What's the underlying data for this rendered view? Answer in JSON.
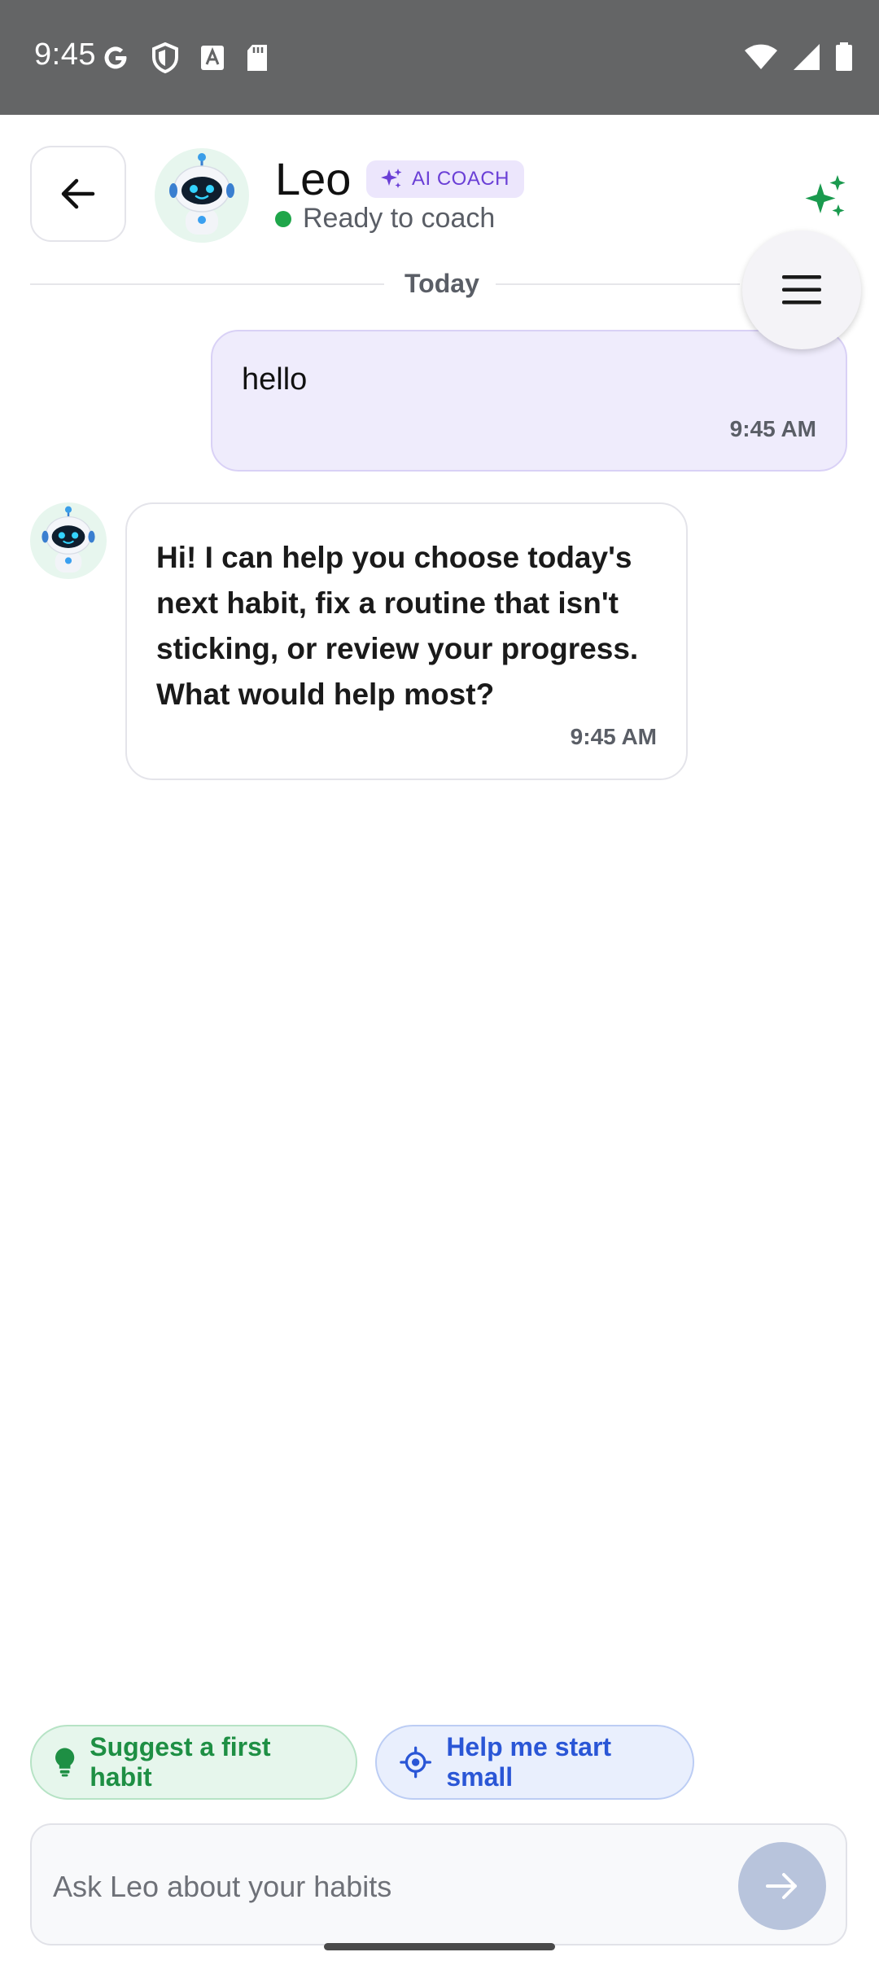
{
  "status_bar": {
    "time": "9:45",
    "left_icons": [
      "google-icon",
      "shield-icon",
      "font-icon",
      "sd-card-icon"
    ],
    "right_icons": [
      "wifi-icon",
      "signal-icon",
      "battery-icon"
    ]
  },
  "header": {
    "coach_name": "Leo",
    "badge_label": "AI COACH",
    "status_text": "Ready to coach",
    "status_color": "#1fa64a"
  },
  "divider": {
    "label": "Today"
  },
  "messages": [
    {
      "sender": "user",
      "text": "hello",
      "time": "9:45 AM"
    },
    {
      "sender": "coach",
      "text": "Hi! I can help you choose today's next habit, fix a routine that isn't sticking, or review your progress. What would help most?",
      "time": "9:45 AM"
    }
  ],
  "suggestions": [
    {
      "label": "Suggest a first habit",
      "icon": "lightbulb-icon",
      "color": "#1e8f44"
    },
    {
      "label": "Help me start small",
      "icon": "target-icon",
      "color": "#2a56d6"
    }
  ],
  "composer": {
    "placeholder": "Ask Leo about your habits",
    "value": ""
  },
  "colors": {
    "accent_purple": "#6a3fd6",
    "user_bubble": "#efecfc",
    "sparkle_green": "#1a9a4e",
    "send_button": "#b8c4dc"
  }
}
